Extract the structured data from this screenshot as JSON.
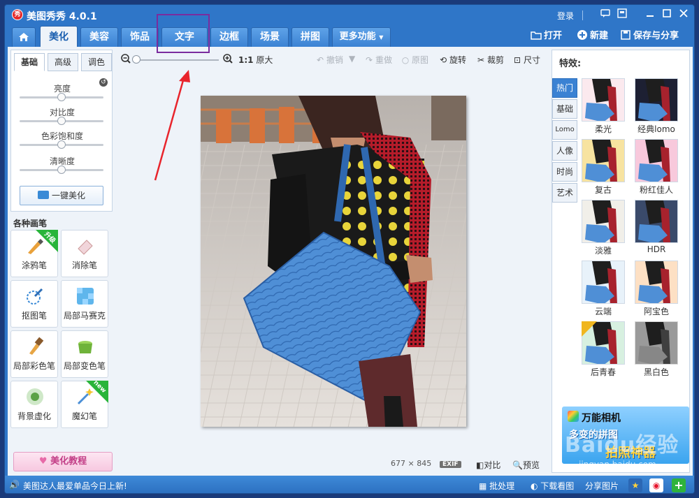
{
  "app": {
    "title": "美图秀秀 4.0.1",
    "logo_text": "秀"
  },
  "titlebar": {
    "login": "登录"
  },
  "tabs": [
    {
      "label": "美化"
    },
    {
      "label": "美容"
    },
    {
      "label": "饰品"
    },
    {
      "label": "文字"
    },
    {
      "label": "边框"
    },
    {
      "label": "场景"
    },
    {
      "label": "拼图"
    },
    {
      "label": "更多功能"
    }
  ],
  "header_actions": {
    "open": "打开",
    "new": "新建",
    "save_share": "保存与分享"
  },
  "adjust": {
    "subtabs": [
      "基础",
      "高级",
      "调色"
    ],
    "sliders": [
      {
        "label": "亮度",
        "level": 0.5
      },
      {
        "label": "对比度",
        "level": 0.5
      },
      {
        "label": "色彩饱和度",
        "level": 0.5
      },
      {
        "label": "清晰度",
        "level": 0.5
      }
    ],
    "auto_button": "一键美化"
  },
  "brushes": {
    "title": "各种画笔",
    "items": [
      {
        "label": "涂鸦笔",
        "tag": "升级"
      },
      {
        "label": "消除笔"
      },
      {
        "label": "抠图笔"
      },
      {
        "label": "局部马赛克"
      },
      {
        "label": "局部彩色笔"
      },
      {
        "label": "局部变色笔"
      },
      {
        "label": "背景虚化"
      },
      {
        "label": "魔幻笔",
        "tag": "new"
      }
    ]
  },
  "tutorial": "美化教程",
  "toolbar": {
    "ratio": "1:1",
    "original_size": "原大",
    "undo": "撤销",
    "redo": "重做",
    "original": "原图",
    "rotate": "旋转",
    "crop": "裁剪",
    "size": "尺寸"
  },
  "image_info": {
    "width": "677",
    "times": "×",
    "height": "845",
    "exif": "EXIF",
    "compare": "对比",
    "preview": "预览"
  },
  "effects": {
    "title": "特效:",
    "categories": [
      "热门",
      "基础",
      "Lomo",
      "人像",
      "时尚",
      "艺术"
    ],
    "items": [
      {
        "label": "柔光"
      },
      {
        "label": "经典lomo"
      },
      {
        "label": "复古"
      },
      {
        "label": "粉红佳人"
      },
      {
        "label": "淡雅"
      },
      {
        "label": "HDR"
      },
      {
        "label": "云端"
      },
      {
        "label": "阿宝色"
      },
      {
        "label": "后青春"
      },
      {
        "label": "黑白色"
      }
    ],
    "ad": {
      "title": "万能相机",
      "sub": "多变的拼图",
      "sub2": "拍照神器"
    }
  },
  "status": {
    "message": "美图达人最爱单品今日上新!",
    "batch": "批处理",
    "download": "下载看图",
    "share": "分享图片"
  },
  "watermark": {
    "brand": "Baidu经验",
    "url": "jingyan.baidu.com"
  },
  "colors": {
    "chrome_blue": "#2f76c8",
    "annotation_purple": "#7a2c9e",
    "annotation_red": "#e8242c"
  }
}
